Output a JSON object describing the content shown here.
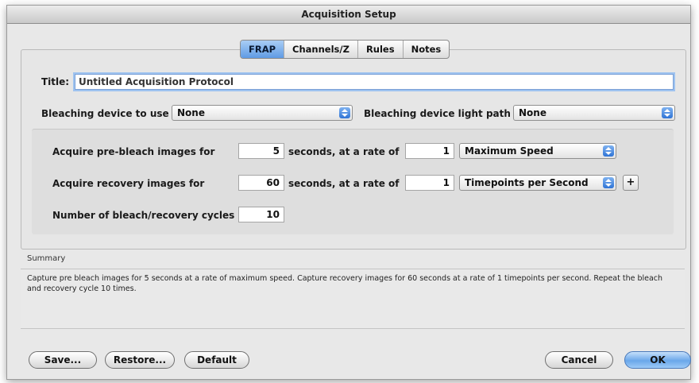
{
  "window": {
    "title": "Acquisition Setup"
  },
  "tabs": [
    {
      "label": "FRAP",
      "active": true
    },
    {
      "label": "Channels/Z",
      "active": false
    },
    {
      "label": "Rules",
      "active": false
    },
    {
      "label": "Notes",
      "active": false
    }
  ],
  "form": {
    "title_label": "Title:",
    "title_value": "Untitled Acquisition Protocol",
    "bleach_device_label": "Bleaching device to use",
    "bleach_device_value": "None",
    "light_path_label": "Bleaching device light path",
    "light_path_value": "None"
  },
  "acquire": {
    "pre_label": "Acquire pre-bleach images for",
    "pre_seconds": "5",
    "pre_rate_text": "seconds, at a rate of",
    "pre_rate": "1",
    "pre_mode": "Maximum Speed",
    "rec_label": "Acquire recovery images for",
    "rec_seconds": "60",
    "rec_rate_text": "seconds, at a rate of",
    "rec_rate": "1",
    "rec_mode": "Timepoints per Second",
    "plus_label": "+",
    "cycles_label": "Number of bleach/recovery cycles",
    "cycles_value": "10"
  },
  "summary": {
    "label": "Summary",
    "text": "Capture pre bleach images for 5 seconds at a rate of maximum speed. Capture recovery images for 60 seconds at a rate of 1 timepoints per second. Repeat the bleach and recovery cycle 10 times."
  },
  "buttons": {
    "save": "Save...",
    "restore": "Restore...",
    "default": "Default",
    "cancel": "Cancel",
    "ok": "OK"
  },
  "colors": {
    "accent": "#5f9be4",
    "window_bg": "#e8e8e8"
  }
}
